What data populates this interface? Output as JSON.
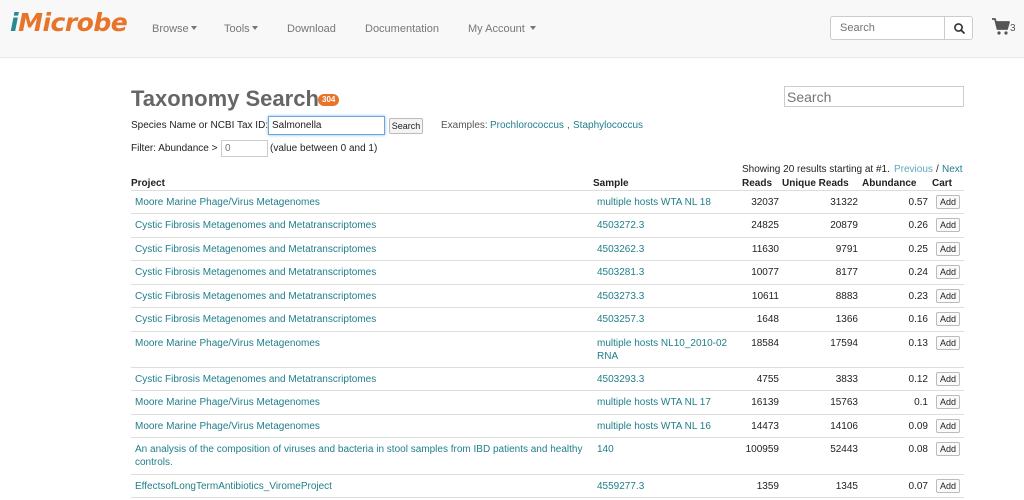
{
  "brand": {
    "prefix": "i",
    "rest": "Microbe"
  },
  "nav": {
    "items": [
      {
        "label": "Browse",
        "dropdown": true
      },
      {
        "label": "Tools",
        "dropdown": true
      },
      {
        "label": "Download",
        "dropdown": false
      },
      {
        "label": "Documentation",
        "dropdown": false
      },
      {
        "label": "My Account",
        "dropdown": true
      }
    ],
    "search_placeholder": "Search",
    "cart_count": "3"
  },
  "page": {
    "title": "Taxonomy Search",
    "result_count": "304",
    "search_placeholder": "Search"
  },
  "form": {
    "species_label": "Species Name or NCBI Tax ID:",
    "species_value": "Salmonella",
    "search_button": "Search",
    "examples_label": "Examples:",
    "example_1": "Prochlorococcus",
    "example_2": "Staphylococcus",
    "abundance_label": "Filter: Abundance >",
    "abundance_placeholder": "0",
    "abundance_hint": "(value between 0 and 1)"
  },
  "results": {
    "showing": "Showing 20 results starting at #1.",
    "previous": "Previous",
    "separator": "/",
    "next": "Next"
  },
  "table": {
    "headers": {
      "project": "Project",
      "sample": "Sample",
      "reads": "Reads",
      "unique_reads": "Unique Reads",
      "abundance": "Abundance",
      "cart": "Cart"
    },
    "add_label": "Add",
    "rows": [
      {
        "project": "Moore Marine Phage/Virus Metagenomes",
        "sample": "multiple hosts WTA NL 18",
        "reads": "32037",
        "unique_reads": "31322",
        "abundance": "0.57"
      },
      {
        "project": "Cystic Fibrosis Metagenomes and Metatranscriptomes",
        "sample": "4503272.3",
        "reads": "24825",
        "unique_reads": "20879",
        "abundance": "0.26"
      },
      {
        "project": "Cystic Fibrosis Metagenomes and Metatranscriptomes",
        "sample": "4503262.3",
        "reads": "11630",
        "unique_reads": "9791",
        "abundance": "0.25"
      },
      {
        "project": "Cystic Fibrosis Metagenomes and Metatranscriptomes",
        "sample": "4503281.3",
        "reads": "10077",
        "unique_reads": "8177",
        "abundance": "0.24"
      },
      {
        "project": "Cystic Fibrosis Metagenomes and Metatranscriptomes",
        "sample": "4503273.3",
        "reads": "10611",
        "unique_reads": "8883",
        "abundance": "0.23"
      },
      {
        "project": "Cystic Fibrosis Metagenomes and Metatranscriptomes",
        "sample": "4503257.3",
        "reads": "1648",
        "unique_reads": "1366",
        "abundance": "0.16"
      },
      {
        "project": "Moore Marine Phage/Virus Metagenomes",
        "sample": "multiple hosts NL10_2010-02 RNA",
        "reads": "18584",
        "unique_reads": "17594",
        "abundance": "0.13"
      },
      {
        "project": "Cystic Fibrosis Metagenomes and Metatranscriptomes",
        "sample": "4503293.3",
        "reads": "4755",
        "unique_reads": "3833",
        "abundance": "0.12"
      },
      {
        "project": "Moore Marine Phage/Virus Metagenomes",
        "sample": "multiple hosts WTA NL 17",
        "reads": "16139",
        "unique_reads": "15763",
        "abundance": "0.1"
      },
      {
        "project": "Moore Marine Phage/Virus Metagenomes",
        "sample": "multiple hosts WTA NL 16",
        "reads": "14473",
        "unique_reads": "14106",
        "abundance": "0.09"
      },
      {
        "project": "An analysis of the composition of viruses and bacteria in stool samples from IBD patients and healthy controls.",
        "sample": "140",
        "reads": "100959",
        "unique_reads": "52443",
        "abundance": "0.08"
      },
      {
        "project": "EffectsofLongTermAntibiotics_ViromeProject",
        "sample": "4559277.3",
        "reads": "1359",
        "unique_reads": "1345",
        "abundance": "0.07"
      }
    ]
  }
}
